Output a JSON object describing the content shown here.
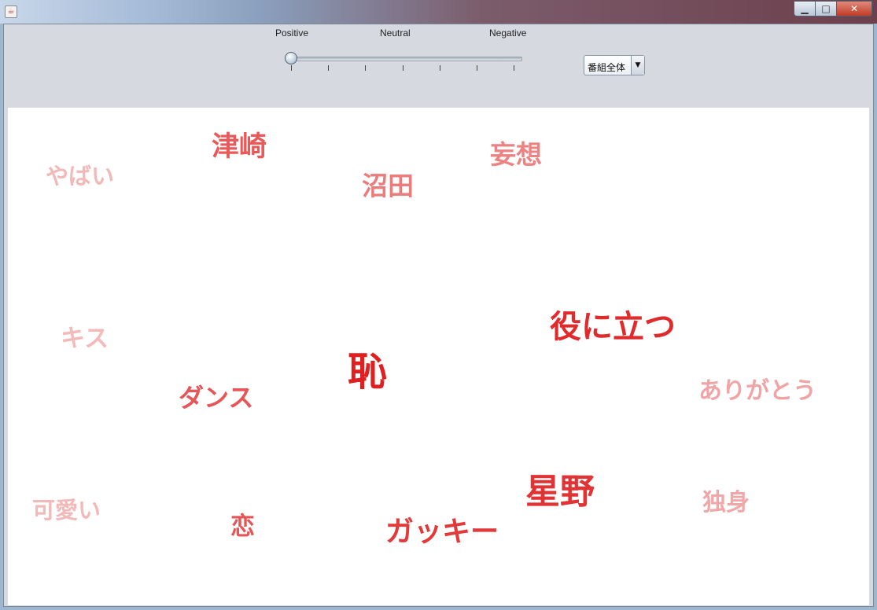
{
  "window": {
    "controls": {
      "minimize": "▁",
      "maximize": "□",
      "close": "✕"
    },
    "app_icon": "java-icon"
  },
  "toolbar": {
    "slider": {
      "labels": {
        "positive": "Positive",
        "neutral": "Neutral",
        "negative": "Negative"
      },
      "value": 0,
      "tick_count": 7
    },
    "scope_dropdown": {
      "selected": "番組全体"
    }
  },
  "word_cloud": {
    "words": [
      {
        "text": "やばい",
        "color": "#f2b9b9"
      },
      {
        "text": "津崎",
        "color": "#e9595a"
      },
      {
        "text": "沼田",
        "color": "#ec7b7c"
      },
      {
        "text": "妄想",
        "color": "#ed8283"
      },
      {
        "text": "キス",
        "color": "#f4baba"
      },
      {
        "text": "役に立つ",
        "color": "#e12a2b"
      },
      {
        "text": "恥",
        "color": "#e01f20"
      },
      {
        "text": "ダンス",
        "color": "#e65557"
      },
      {
        "text": "ありがとう",
        "color": "#f1a4a5"
      },
      {
        "text": "可愛い",
        "color": "#f2b9b9"
      },
      {
        "text": "恋",
        "color": "#e75455"
      },
      {
        "text": "ガッキー",
        "color": "#e2393a"
      },
      {
        "text": "星野",
        "color": "#e13334"
      },
      {
        "text": "独身",
        "color": "#f1a6a7"
      }
    ]
  }
}
